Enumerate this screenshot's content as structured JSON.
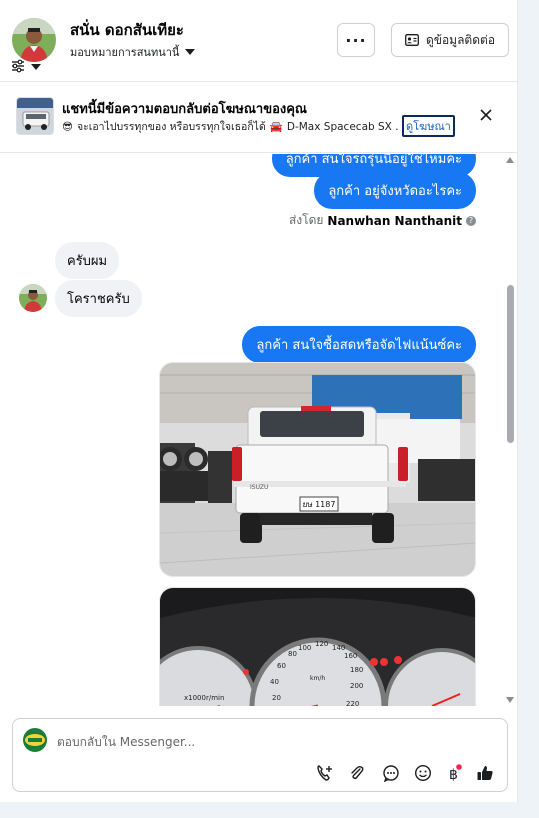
{
  "header": {
    "contact_name": "สนั่น ดอกสันเทียะ",
    "assign_label": "มอบหมายการสนทนานี้",
    "more_label": "···",
    "contact_info_label": "ดูข้อมูลติดต่อ"
  },
  "ad_banner": {
    "title": "แชทนี้มีข้อความตอบกลับต่อโฆษณาของคุณ",
    "emoji": "😎",
    "subtitle": "จะเอาไปบรรทุกของ หรือบรรทุกใจเธอก็ได้",
    "car_emoji": "🚘",
    "subtitle_model": "D-Max Spacecab SX ...",
    "link_label": "ดูโฆษณา"
  },
  "chat": {
    "messages": [
      {
        "from": "page",
        "text": "ลูกค้า สนใจรถรุ่นนี้อยู่ใช่ไหมคะ"
      },
      {
        "from": "page",
        "text": "ลูกค้า อยู่จังหวัดอะไรคะ"
      },
      {
        "from": "customer",
        "text": "ครับผม"
      },
      {
        "from": "customer",
        "text": "โคราชครับ"
      },
      {
        "from": "page",
        "text": "ลูกค้า สนใจซื้อสดหรือจัดไฟแน้นซ์คะ"
      }
    ],
    "sent_by_prefix": "ส่งโดย",
    "sent_by_name": "Nanwhan Nanthanit",
    "photo1": {
      "plate": "ยษ 1187",
      "brand": "ISUZU"
    },
    "photo2": {
      "unit": "x1000r/min",
      "kmh": "km/h",
      "ticks": [
        "20",
        "40",
        "60",
        "80",
        "100",
        "120",
        "140",
        "160",
        "180",
        "200",
        "220"
      ]
    }
  },
  "composer": {
    "placeholder": "ตอบกลับใน Messenger..."
  },
  "colors": {
    "accent": "#1877f2",
    "bubble_in": "#f0f2f5",
    "link": "#1a62c5"
  }
}
